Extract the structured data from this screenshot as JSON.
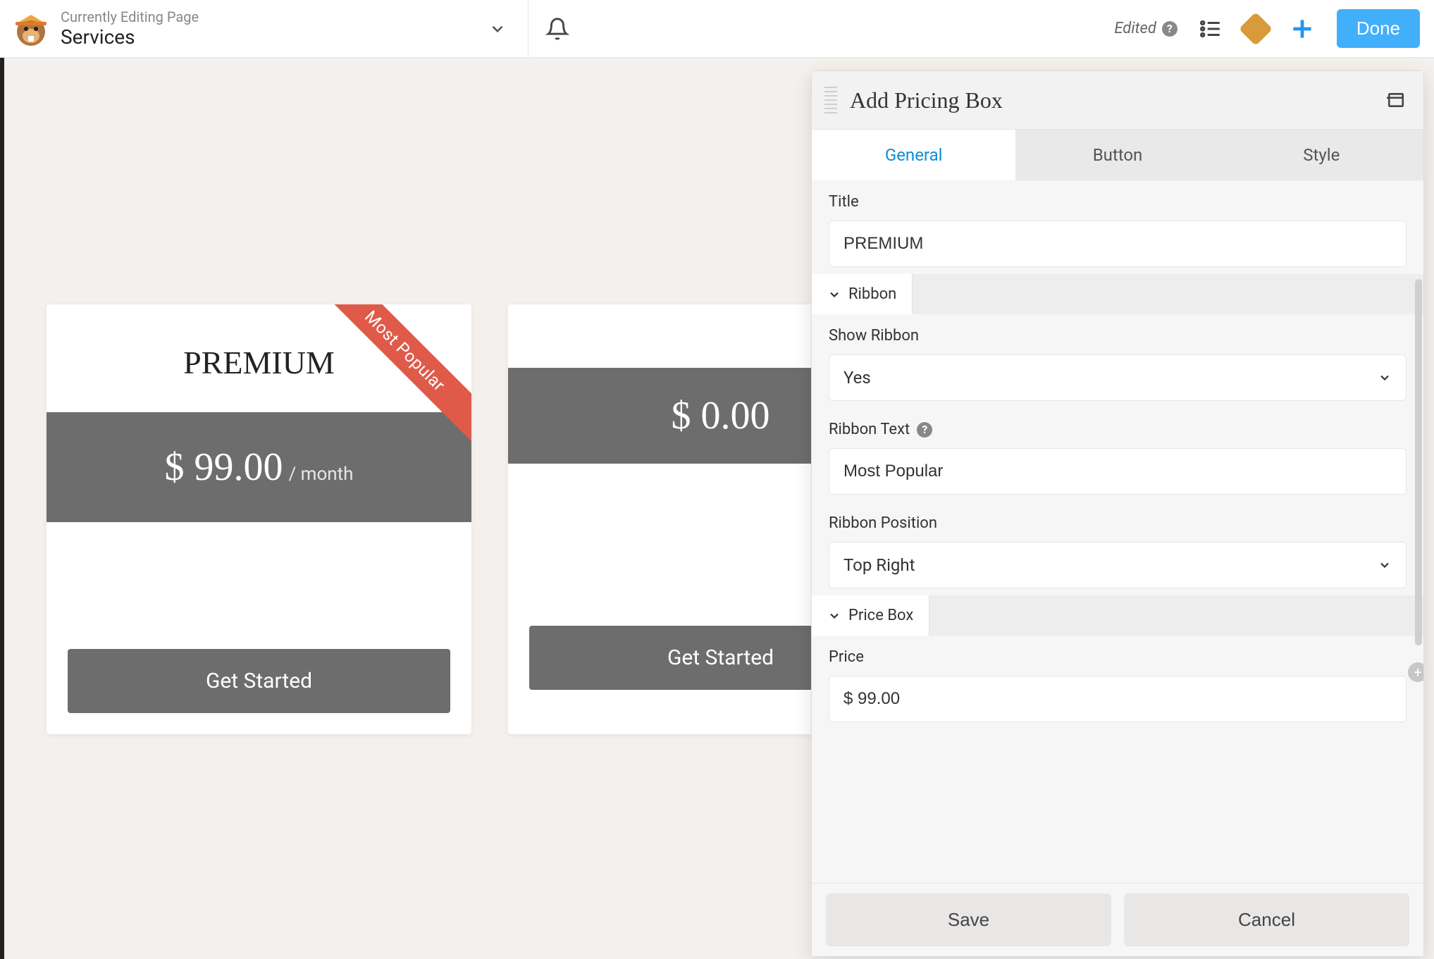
{
  "topbar": {
    "editing_label": "Currently Editing Page",
    "page_title": "Services",
    "edited_label": "Edited",
    "done_label": "Done"
  },
  "cards": [
    {
      "title": "PREMIUM",
      "price": "$ 99.00",
      "period": "/ month",
      "button": "Get Started",
      "ribbon": "Most Popular"
    },
    {
      "title": "",
      "price": "$ 0.00",
      "period": "",
      "button": "Get Started"
    }
  ],
  "panel": {
    "title": "Add Pricing Box",
    "tabs": {
      "general": "General",
      "button": "Button",
      "style": "Style"
    },
    "fields": {
      "title_label": "Title",
      "title_value": "PREMIUM",
      "ribbon_section": "Ribbon",
      "show_ribbon_label": "Show Ribbon",
      "show_ribbon_value": "Yes",
      "ribbon_text_label": "Ribbon Text",
      "ribbon_text_value": "Most Popular",
      "ribbon_position_label": "Ribbon Position",
      "ribbon_position_value": "Top Right",
      "pricebox_section": "Price Box",
      "price_label": "Price",
      "price_value": "$ 99.00"
    },
    "footer": {
      "save": "Save",
      "cancel": "Cancel"
    }
  }
}
